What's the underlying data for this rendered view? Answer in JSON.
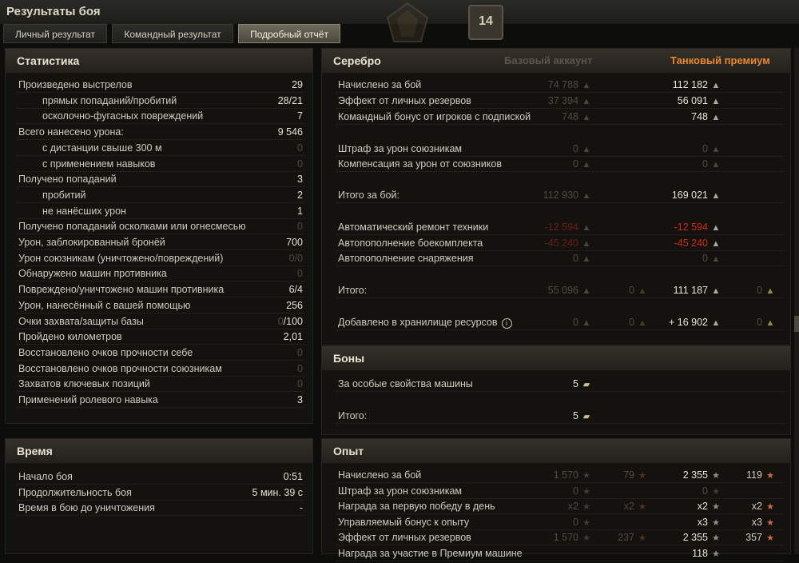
{
  "window": {
    "title": "Результаты боя",
    "level": "14"
  },
  "tabs": [
    {
      "label": "Личный результат",
      "active": false
    },
    {
      "label": "Командный результат",
      "active": false
    },
    {
      "label": "Подробный отчёт",
      "active": true
    }
  ],
  "stats": {
    "header": "Статистика",
    "rows": [
      {
        "label": "Произведено выстрелов",
        "value": "29",
        "indent": 0,
        "dim": false
      },
      {
        "label": "прямых попаданий/пробитий",
        "value": "28/21",
        "indent": 1,
        "dim": false
      },
      {
        "label": "осколочно-фугасных повреждений",
        "value": "7",
        "indent": 1,
        "dim": false
      },
      {
        "label": "Всего нанесено урона:",
        "value": "9 546",
        "indent": 0,
        "dim": false
      },
      {
        "label": "с дистанции свыше 300 м",
        "value": "0",
        "indent": 1,
        "dim": true
      },
      {
        "label": "с применением навыков",
        "value": "0",
        "indent": 1,
        "dim": true
      },
      {
        "label": "Получено попаданий",
        "value": "3",
        "indent": 0,
        "dim": false
      },
      {
        "label": "пробитий",
        "value": "2",
        "indent": 1,
        "dim": false
      },
      {
        "label": "не нанёсших урон",
        "value": "1",
        "indent": 1,
        "dim": false
      },
      {
        "label": "Получено попаданий осколками или огнесмесью",
        "value": "0",
        "indent": 0,
        "dim": true
      },
      {
        "label": "Урон, заблокированный бронёй",
        "value": "700",
        "indent": 0,
        "dim": false
      },
      {
        "label": "Урон союзникам (уничтожено/повреждений)",
        "value": "0/0",
        "indent": 0,
        "dim": true
      },
      {
        "label": "Обнаружено машин противника",
        "value": "0",
        "indent": 0,
        "dim": true
      },
      {
        "label": "Повреждено/уничтожено машин противника",
        "value": "6/4",
        "indent": 0,
        "dim": false
      },
      {
        "label": "Урон, нанесённый с вашей помощью",
        "value": "256",
        "indent": 0,
        "dim": false
      },
      {
        "label": "Очки захвата/защиты базы",
        "value_dim": "0",
        "value": "/100",
        "indent": 0,
        "dim": false
      },
      {
        "label": "Пройдено километров",
        "value": "2,01",
        "indent": 0,
        "dim": false
      },
      {
        "label": "Восстановлено очков прочности себе",
        "value": "0",
        "indent": 0,
        "dim": true
      },
      {
        "label": "Восстановлено очков прочности союзникам",
        "value": "0",
        "indent": 0,
        "dim": true
      },
      {
        "label": "Захватов ключевых позиций",
        "value": "0",
        "indent": 0,
        "dim": true
      },
      {
        "label": "Применений ролевого навыка",
        "value": "3",
        "indent": 0,
        "dim": false
      }
    ]
  },
  "time": {
    "header": "Время",
    "rows": [
      {
        "label": "Начало боя",
        "value": "0:51"
      },
      {
        "label": "Продолжительность боя",
        "value": "5 мин. 39 с"
      },
      {
        "label": "Время в бою до уничтожения",
        "value": "-"
      }
    ]
  },
  "silver": {
    "header": "Серебро",
    "col_basic": "Базовый аккаунт",
    "col_premium": "Танковый премиум",
    "colors": {
      "premium": "#e88a2a",
      "negative": "#d02a1c"
    },
    "rows": [
      {
        "label": "Начислено за бой",
        "basic": "74 788",
        "premium": "112 182"
      },
      {
        "label": "Эффект от личных резервов",
        "basic": "37 394",
        "premium": "56 091"
      },
      {
        "label": "Командный бонус от игроков с подпиской",
        "basic": "748",
        "premium": "748"
      },
      {
        "label": "Штраф за урон союзникам",
        "basic": "0",
        "premium": "0",
        "dim_premium": true
      },
      {
        "label": "Компенсация за урон от союзников",
        "basic": "0",
        "premium": "0",
        "dim_premium": true
      },
      {
        "label": "Итого за бой:",
        "basic": "112 930",
        "premium": "169 021"
      },
      {
        "label": "Автоматический ремонт техники",
        "basic": "-12 594",
        "premium": "-12 594",
        "negative": true
      },
      {
        "label": "Автопополнение боекомплекта",
        "basic": "-45 240",
        "premium": "-45 240",
        "negative": true
      },
      {
        "label": "Автопополнение снаряжения",
        "basic": "0",
        "premium": "0",
        "dim_premium": true
      },
      {
        "label": "Итого:",
        "basic": "55 096",
        "basic_gold": "0",
        "premium": "111 187",
        "premium_gold": "0"
      },
      {
        "label": "Добавлено в хранилище ресурсов",
        "basic": "0",
        "basic_gold": "0",
        "premium": "+ 16 902",
        "premium_gold": "0",
        "info": true
      }
    ]
  },
  "bonds": {
    "header": "Боны",
    "rows": [
      {
        "label": "За особые свойства машины",
        "value": "5"
      },
      {
        "label": "Итого:",
        "value": "5"
      }
    ]
  },
  "xp": {
    "header": "Опыт",
    "rows": [
      {
        "label": "Начислено за бой",
        "b_xp": "1 570",
        "b_fxp": "79",
        "p_xp": "2 355",
        "p_fxp": "119"
      },
      {
        "label": "Штраф за урон союзникам",
        "b_xp": "0",
        "b_fxp": "",
        "p_xp": "0",
        "p_fxp": "",
        "dim_p": true
      },
      {
        "label": "Награда за первую победу в день",
        "b_xp": "x2",
        "b_fxp": "x2",
        "p_xp": "x2",
        "p_fxp": "x2"
      },
      {
        "label": "Управляемый бонус к опыту",
        "b_xp": "0",
        "b_fxp": "",
        "p_xp": "x3",
        "p_fxp": "x3"
      },
      {
        "label": "Эффект от личных резервов",
        "b_xp": "1 570",
        "b_fxp": "237",
        "p_xp": "2 355",
        "p_fxp": "357"
      },
      {
        "label": "Награда за участие в Премиум машине",
        "b_xp": "",
        "b_fxp": "",
        "p_xp": "118",
        "p_fxp": ""
      }
    ]
  },
  "icons": {
    "silver": "silver-coin-icon",
    "gold": "gold-coin-icon",
    "xp": "xp-star-icon",
    "free_xp": "free-xp-star-icon",
    "bond": "bond-icon",
    "info": "info-icon"
  }
}
